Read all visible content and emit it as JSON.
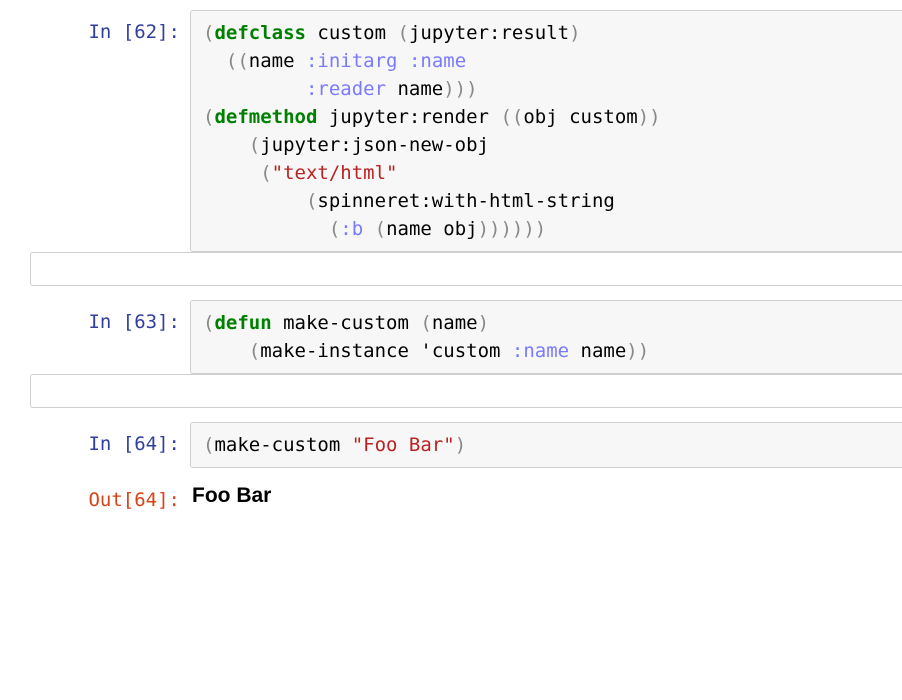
{
  "prompts": {
    "in62": "In [62]:",
    "in63": "In [63]:",
    "in64": "In [64]:",
    "out64": "Out[64]:"
  },
  "cell62": {
    "l1_open": "(",
    "l1_kw": "defclass",
    "l1_rest": " custom ",
    "l1_paren_open2": "(",
    "l1_parent": "jupyter:result",
    "l1_close": ")",
    "l2_indent": "  ",
    "l2_open": "((",
    "l2_name": "name ",
    "l2_initarg": ":initarg",
    "l2_space": " ",
    "l2_nkey": ":name",
    "l3_indent": "         ",
    "l3_reader": ":reader",
    "l3_rest": " name",
    "l3_close": ")))",
    "l4_blank": "",
    "l5_open": "(",
    "l5_kw": "defmethod",
    "l5_mid": " jupyter:render ",
    "l5_open2": "((",
    "l5_args": "obj custom",
    "l5_close": "))",
    "l6_indent": "    ",
    "l6_open": "(",
    "l6_fn": "jupyter:json-new-obj",
    "l7_indent": "     ",
    "l7_open": "(",
    "l7_str": "\"text/html\"",
    "l8_indent": "         ",
    "l8_open": "(",
    "l8_fn": "spinneret:with-html-string",
    "l9_indent": "           ",
    "l9_open": "(",
    "l9_bkey": ":b",
    "l9_space": " ",
    "l9_open2": "(",
    "l9_call": "name obj",
    "l9_close": "))))))"
  },
  "cell63": {
    "l1_open": "(",
    "l1_kw": "defun",
    "l1_mid": " make-custom ",
    "l1_open2": "(",
    "l1_args": "name",
    "l1_close": ")",
    "l2_indent": "    ",
    "l2_open": "(",
    "l2_fn": "make-instance ",
    "l2_quote": "'custom ",
    "l2_nkey": ":name",
    "l2_rest": " name",
    "l2_close": "))"
  },
  "cell64": {
    "l1_open": "(",
    "l1_fn": "make-custom ",
    "l1_str": "\"Foo Bar\"",
    "l1_close": ")"
  },
  "output64": {
    "html_text": "Foo Bar"
  }
}
